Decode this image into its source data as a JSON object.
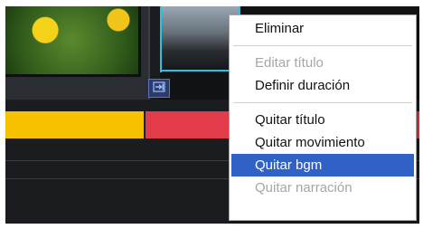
{
  "context_menu": {
    "items": [
      {
        "label": "Eliminar",
        "state": "enabled"
      },
      {
        "label": "Editar título",
        "state": "disabled"
      },
      {
        "label": "Definir duración",
        "state": "enabled"
      },
      {
        "label": "Quitar título",
        "state": "enabled"
      },
      {
        "label": "Quitar movimiento",
        "state": "enabled"
      },
      {
        "label": "Quitar bgm",
        "state": "highlighted"
      },
      {
        "label": "Quitar narración",
        "state": "disabled"
      }
    ]
  },
  "editor": {
    "transition_icon": "transition-icon",
    "track_colors": {
      "video_track": "#f6c200",
      "audio_track": "#e23c4a"
    },
    "accent_color": "#1ec8e6"
  }
}
